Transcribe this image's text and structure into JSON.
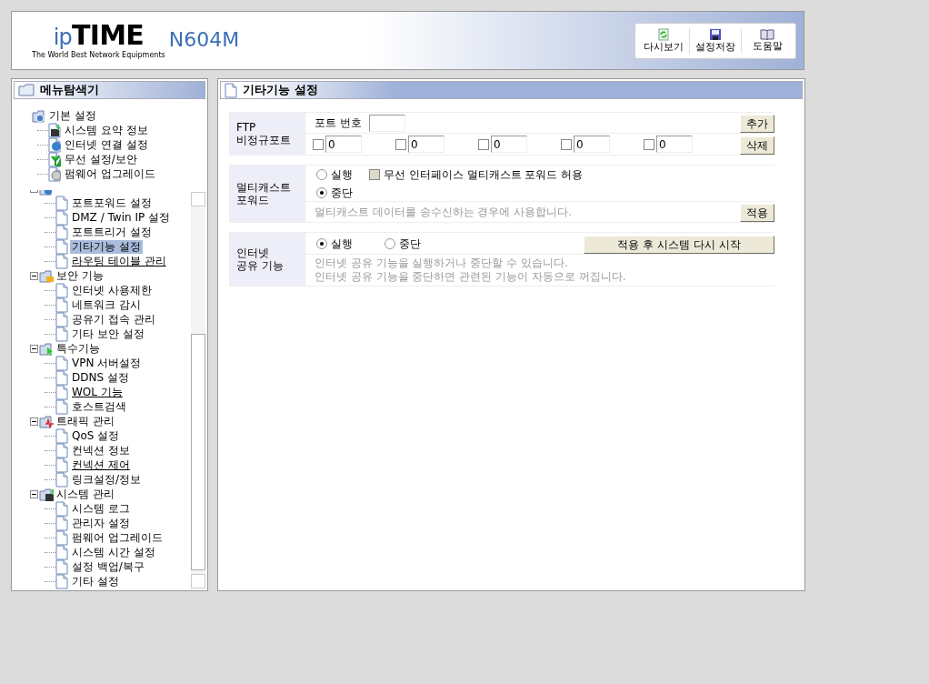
{
  "header": {
    "logo": "ipTIME",
    "tagline": "The World Best Network Equipments",
    "model": "N604M",
    "toolbar": [
      {
        "label": "다시보기",
        "kind": "refresh"
      },
      {
        "label": "설정저장",
        "kind": "save"
      },
      {
        "label": "도움말",
        "kind": "help"
      }
    ]
  },
  "sidebar": {
    "title": "메뉴탐색기",
    "top": [
      {
        "label": "기본 설정",
        "kind": "gear",
        "children": [
          {
            "label": "시스템 요약 정보",
            "kind": "monitor"
          },
          {
            "label": "인터넷 연결 설정",
            "kind": "globe"
          },
          {
            "label": "무선 설정/보안",
            "kind": "antenna"
          },
          {
            "label": "펌웨어 업그레이드",
            "kind": "disc"
          }
        ]
      }
    ],
    "scrolled": [
      {
        "kind": "globe",
        "children": [
          {
            "label": "포트포워드 설정",
            "selected": false,
            "underlined": false
          },
          {
            "label": "DMZ / Twin IP 설정",
            "selected": false,
            "underlined": false
          },
          {
            "label": "포트트리거 설정",
            "selected": false,
            "underlined": false
          },
          {
            "label": "기타기능 설정",
            "selected": true,
            "underlined": false
          },
          {
            "label": "라우팅 테이블 관리",
            "selected": false,
            "underlined": true
          }
        ]
      },
      {
        "label": "보안 기능",
        "kind": "lock",
        "children": [
          {
            "label": "인터넷 사용제한",
            "selected": false,
            "underlined": false
          },
          {
            "label": "네트워크 감시",
            "selected": false,
            "underlined": false
          },
          {
            "label": "공유기 접속 관리",
            "selected": false,
            "underlined": false
          },
          {
            "label": "기타 보안 설정",
            "selected": false,
            "underlined": false
          }
        ]
      },
      {
        "label": "특수기능",
        "kind": "cursor",
        "children": [
          {
            "label": "VPN 서버설정",
            "selected": false,
            "underlined": false
          },
          {
            "label": "DDNS 설정",
            "selected": false,
            "underlined": false
          },
          {
            "label": "WOL 기능",
            "selected": false,
            "underlined": true
          },
          {
            "label": "호스트검색",
            "selected": false,
            "underlined": false
          }
        ]
      },
      {
        "label": "트래픽 관리",
        "kind": "pulse",
        "children": [
          {
            "label": "QoS 설정",
            "selected": false,
            "underlined": false
          },
          {
            "label": "컨넥션 정보",
            "selected": false,
            "underlined": false
          },
          {
            "label": "컨넥션 제어",
            "selected": false,
            "underlined": true
          },
          {
            "label": "링크설정/정보",
            "selected": false,
            "underlined": false
          }
        ]
      },
      {
        "label": "시스템 관리",
        "kind": "monitor",
        "children": [
          {
            "label": "시스템 로그",
            "selected": false,
            "underlined": false
          },
          {
            "label": "관리자 설정",
            "selected": false,
            "underlined": false
          },
          {
            "label": "펌웨어 업그레이드",
            "selected": false,
            "underlined": false
          },
          {
            "label": "시스템 시간 설정",
            "selected": false,
            "underlined": false
          },
          {
            "label": "설정 백업/복구",
            "selected": false,
            "underlined": false
          },
          {
            "label": "기타 설정",
            "selected": false,
            "underlined": false
          }
        ]
      }
    ]
  },
  "main": {
    "title": "기타기능 설정",
    "ftp": {
      "label": [
        "FTP",
        "비정규포트"
      ],
      "port_label": "포트 번호",
      "add": "추가",
      "delete": "삭제",
      "ports": [
        {
          "value": "0",
          "checked": false
        },
        {
          "value": "0",
          "checked": false
        },
        {
          "value": "0",
          "checked": false
        },
        {
          "value": "0",
          "checked": false
        },
        {
          "value": "0",
          "checked": false
        }
      ]
    },
    "multicast": {
      "label": [
        "멀티캐스트",
        "포워드"
      ],
      "options": [
        {
          "label": "실행",
          "selected": false
        },
        {
          "label": "중단",
          "selected": true
        }
      ],
      "wireless": {
        "label": "무선 인터페이스 멀티캐스트 포워드 허용",
        "checked": false,
        "disabled": true
      },
      "note": "멀티캐스트 데이터를 송수신하는 경우에 사용합니다.",
      "apply": "적용"
    },
    "sharing": {
      "label": [
        "인터넷",
        "공유 기능"
      ],
      "options": [
        {
          "label": "실행",
          "selected": true
        },
        {
          "label": "중단",
          "selected": false
        }
      ],
      "apply": "적용 후 시스템 다시 시작",
      "notes": [
        "인터넷 공유 기능을 실행하거나 중단할 수 있습니다.",
        "인터넷 공유 기능을 중단하면 관련된 기능이 자동으로 꺼집니다."
      ]
    }
  }
}
